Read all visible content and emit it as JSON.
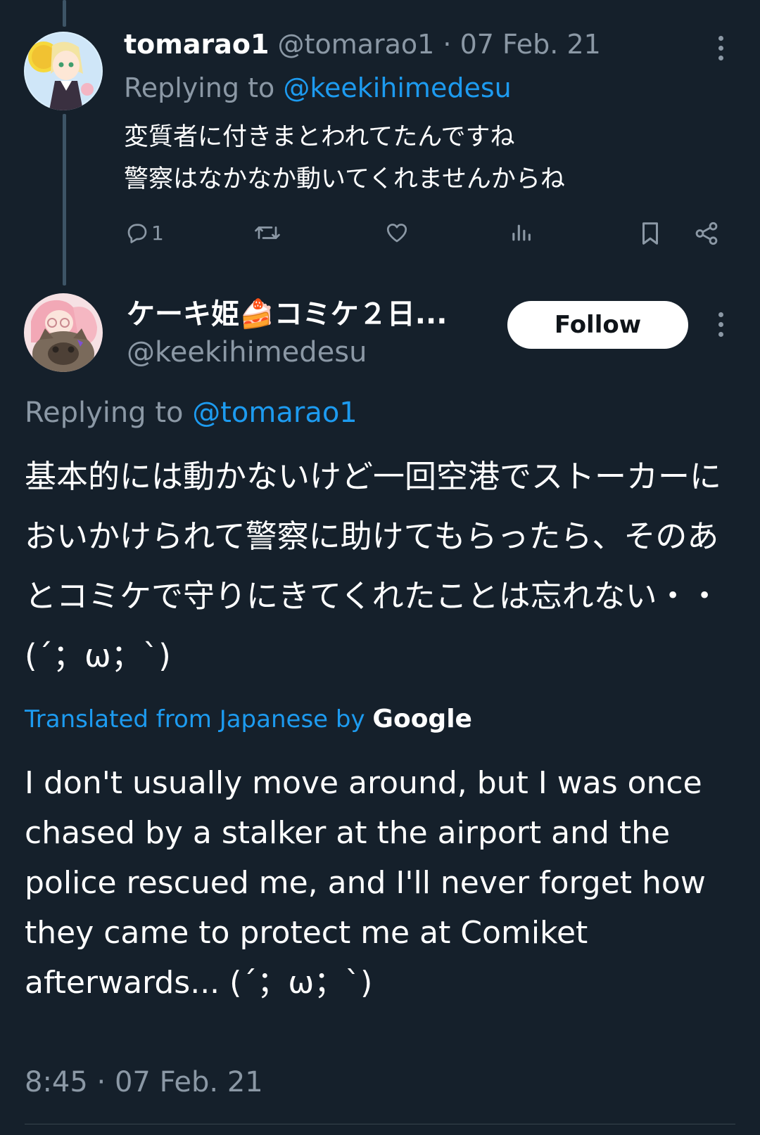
{
  "reply_tweet": {
    "display_name": "tomarao1",
    "handle": "@tomarao1",
    "separator": " · ",
    "date": "07 Feb. 21",
    "replying_prefix": "Replying to ",
    "replying_to": "@keekihimedesu",
    "text_lines": [
      "変質者に付きまとわれてたんですね",
      "警察はなかなか動いてくれませんからね"
    ],
    "actions": {
      "reply_count": "1"
    }
  },
  "main_tweet": {
    "display_name": "ケーキ姫🍰コミケ２日...",
    "handle": "@keekihimedesu",
    "follow_label": "Follow",
    "replying_prefix": "Replying to ",
    "replying_to": "@tomarao1",
    "original_text": "基本的には動かないけど一回空港でストーカーにおいかけられて警察に助けてもらったら、そのあとコミケで守りにきてくれたことは忘れない・・(´；ω；`)",
    "translation_label": "Translated from Japanese by ",
    "translation_provider": "Google",
    "translated_text": "I don't usually move around, but I was once chased by a stalker at the airport and the police rescued me, and I'll never forget how they came to protect me at Comiket afterwards... (´；ω；`)",
    "timestamp": "8:45 · 07 Feb. 21"
  },
  "colors": {
    "background": "#15202b",
    "text": "#ffffff",
    "muted": "#8b98a5",
    "link": "#1d9bf0",
    "thread_line": "#3d5466"
  },
  "icons": [
    "more-icon",
    "reply-icon",
    "retweet-icon",
    "like-icon",
    "views-icon",
    "bookmark-icon",
    "share-icon"
  ]
}
